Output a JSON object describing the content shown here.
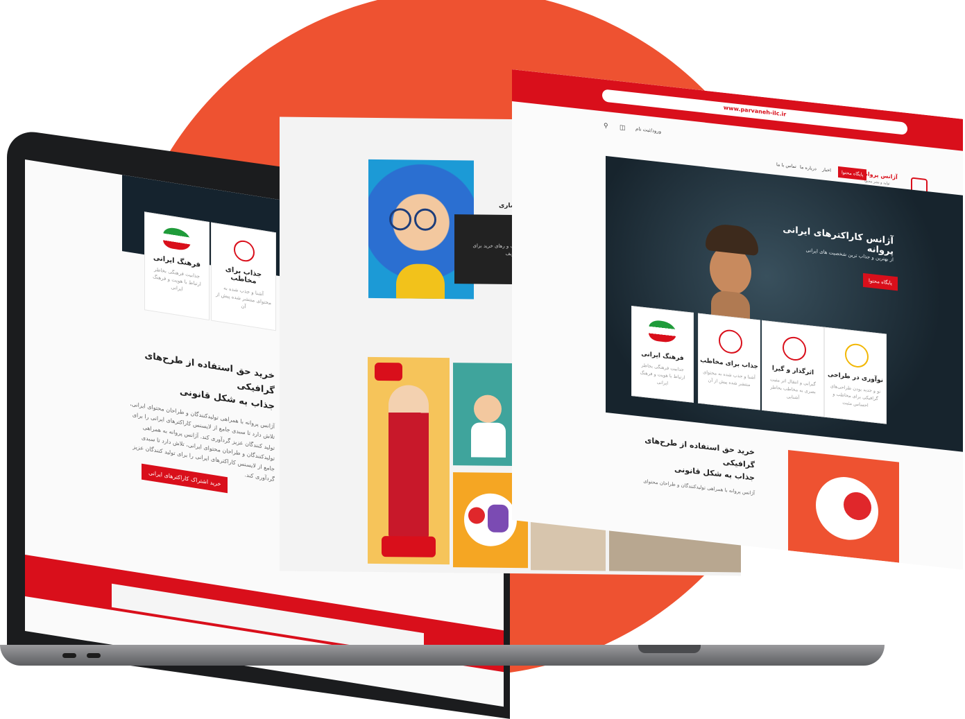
{
  "right_page": {
    "url": "www.parvaneh-ilc.ir",
    "login_label": "ورود/ثبت نام",
    "logo_title": "آژانس پروانه",
    "logo_subtitle": "تولید و نشر محتوا",
    "nav": {
      "active": "پایگاه محتوا",
      "items": [
        "اخبار",
        "درباره ما",
        "تماس با ما"
      ]
    },
    "hero_title": "آژانس کاراکترهای ایرانی پروانه",
    "hero_subtitle": "از بهترین و جذاب ترین شخصیت های ایرانی",
    "hero_button": "پایگاه محتوا",
    "cards": [
      {
        "title": "نوآوری در طراحی",
        "desc": "نو و جدید بودن طراحی‌های گرافیکی برای مخاطب و احساس مثبت"
      },
      {
        "title": "اثرگذار و گیرا",
        "desc": "گیرایی و انتقال اثر مثبت بصری به مخاطب بخاطر آشنایی"
      },
      {
        "title": "جذاب برای مخاطب",
        "desc": "آشنا و جذب شده به محتوای منتشر شده پیش از آن"
      },
      {
        "title": "فرهنگ ایرانی",
        "desc": "جذابیت فرهنگی بخاطر ارتباط با هویت و فرهنگ ایرانی"
      }
    ],
    "section_title_1": "خرید حق استفاده از طرح‌های گرافیکی",
    "section_title_2": "جذاب به شکل قانونی",
    "section_text": "آژانس پروانه با همراهی تولیدکنندگان و طراحان محتوای"
  },
  "laptop_page": {
    "cards": [
      {
        "title": "جذاب برای مخاطب",
        "desc": "آشنا و جذب شده به محتوای منتشر شده پیش از آن"
      },
      {
        "title": "فرهنگ ایرانی",
        "desc": "جذابیت فرهنگی بخاطر ارتباط با هویت و فرهنگ ایرانی"
      }
    ],
    "heading_1": "خرید حق استفاده از طرح‌های گرافیکی",
    "heading_2": "جذاب به شکل قانونی",
    "paragraph": "آژانس پروانه با همراهی تولیدکنندگان و طراحان محتوای ایرانی، تلاش دارد تا سبدی جامع از لایسنس کاراکترهای ایرانی را برای تولید کنندگان عزیز گردآوری کند. آژانس پروانه به همراهی تولیدکنندگان و طراحان محتوای ایرانی، تلاش دارد تا سبدی جامع از لایسنس کاراکترهای ایرانی را برای تولید کنندگان عزیز گردآوری کند.",
    "button": "خرید اشتراک کاراکترهای ایرانی"
  },
  "middle_page": {
    "dark_box_label": "ساری",
    "dark_box_text": "های مختلف و رهای خرید برای مختلف تعریف"
  },
  "colors": {
    "brand_red": "#d90f1b",
    "accent_orange": "#ee5231"
  }
}
